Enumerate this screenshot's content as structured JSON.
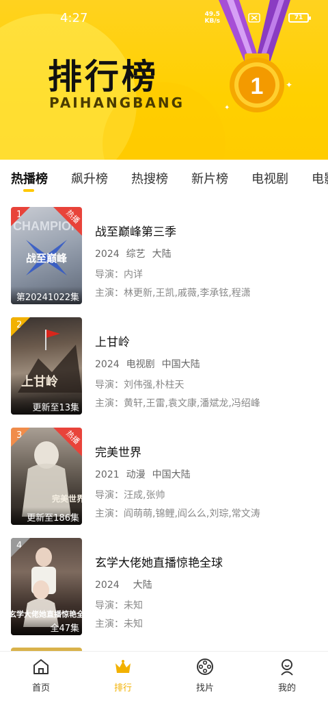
{
  "status": {
    "time": "4:27",
    "net_speed": "49.5",
    "net_unit": "KB/s",
    "battery": "71"
  },
  "header": {
    "title": "排行榜",
    "subtitle": "PAIHANGBANG",
    "medal_number": "1"
  },
  "tabs": [
    {
      "label": "热播榜",
      "active": true
    },
    {
      "label": "飙升榜"
    },
    {
      "label": "热搜榜"
    },
    {
      "label": "新片榜"
    },
    {
      "label": "电视剧"
    },
    {
      "label": "电影"
    }
  ],
  "items": [
    {
      "rank": "1",
      "hot_label": "热播",
      "episode": "第20241022集",
      "title": "战至巅峰第三季",
      "year": "2024",
      "genre": "综艺",
      "region": "大陆",
      "director": "导演：内详",
      "cast": "主演：林更新,王凯,戚薇,李承铉,程潇",
      "rank_color": "#E8433A",
      "poster_text": "战至巅峰"
    },
    {
      "rank": "2",
      "episode": "更新至13集",
      "title": "上甘岭",
      "year": "2024",
      "genre": "电视剧",
      "region": "中国大陆",
      "director": "导演：刘伟强,朴柱天",
      "cast": "主演：黄轩,王雷,袁文康,潘斌龙,冯绍峰",
      "rank_color": "#F2B100",
      "poster_text": "上甘岭"
    },
    {
      "rank": "3",
      "hot_label": "热播",
      "episode": "更新至186集",
      "title": "完美世界",
      "year": "2021",
      "genre": "动漫",
      "region": "中国大陆",
      "director": "导演：汪成,张帅",
      "cast": "主演：阎萌萌,锦鲤,阎么么,刘琮,常文涛",
      "rank_color": "#F08C4A",
      "poster_text": "完美世界"
    },
    {
      "rank": "4",
      "episode": "全47集",
      "title": "玄学大佬她直播惊艳全球",
      "year": "2024",
      "genre": "",
      "region": "大陆",
      "director": "导演：未知",
      "cast": "主演：未知",
      "rank_color": "#9A9A9A",
      "poster_text": "玄学大佬她直播惊艳全"
    }
  ],
  "nav": [
    {
      "label": "首页",
      "icon": "home-icon"
    },
    {
      "label": "排行",
      "icon": "crown-icon",
      "active": true
    },
    {
      "label": "找片",
      "icon": "film-reel-icon"
    },
    {
      "label": "我的",
      "icon": "profile-icon"
    }
  ],
  "colors": {
    "accent": "#FFC800",
    "hot": "#E8433A",
    "banner": "#FFD000"
  }
}
